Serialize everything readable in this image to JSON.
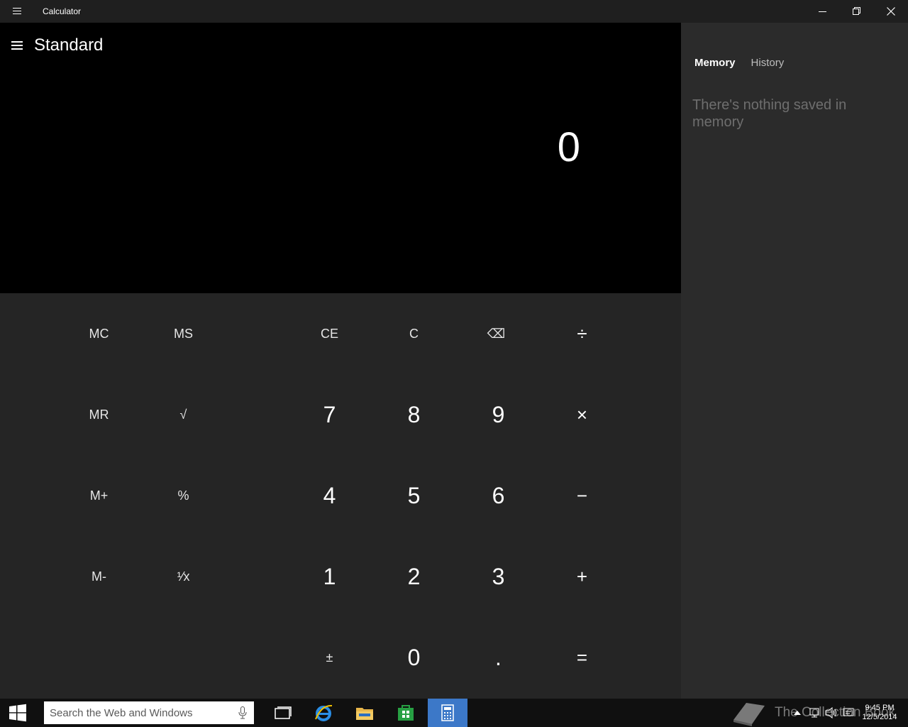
{
  "window": {
    "title": "Calculator"
  },
  "calculator": {
    "mode": "Standard",
    "display_value": "0",
    "memory_keys": [
      "MC",
      "MS",
      "MR",
      "M+",
      "M-"
    ],
    "function_keys": [
      "√",
      "%",
      "¹⁄x",
      "±"
    ],
    "keys": {
      "ce": "CE",
      "c": "C",
      "backspace": "⌫",
      "divide": "÷",
      "multiply": "×",
      "subtract": "−",
      "add": "+",
      "equals": "=",
      "d7": "7",
      "d8": "8",
      "d9": "9",
      "d4": "4",
      "d5": "5",
      "d6": "6",
      "d1": "1",
      "d2": "2",
      "d3": "3",
      "d0": "0",
      "decimal": ".",
      "mc": "MC",
      "ms": "MS",
      "mr": "MR",
      "mplus": "M+",
      "mminus": "M-",
      "sqrt": "√",
      "percent": "%",
      "reciprocal": "¹⁄x",
      "negate": "±"
    }
  },
  "side_panel": {
    "tabs": [
      {
        "label": "Memory",
        "active": true
      },
      {
        "label": "History",
        "active": false
      }
    ],
    "empty_message": "There's nothing saved in memory"
  },
  "taskbar": {
    "search_placeholder": "Search the Web and Windows",
    "apps": [
      "task-view",
      "internet-explorer",
      "file-explorer",
      "store",
      "calculator"
    ],
    "active_app": "calculator",
    "clock_time": "9:45 PM",
    "clock_date": "12/5/2014",
    "watermark": "The Collection Book"
  },
  "colors": {
    "display_bg": "#000000",
    "keypad_bg": "#252525",
    "side_bg": "#2b2b2b",
    "taskbar_active": "#3c78c8"
  }
}
